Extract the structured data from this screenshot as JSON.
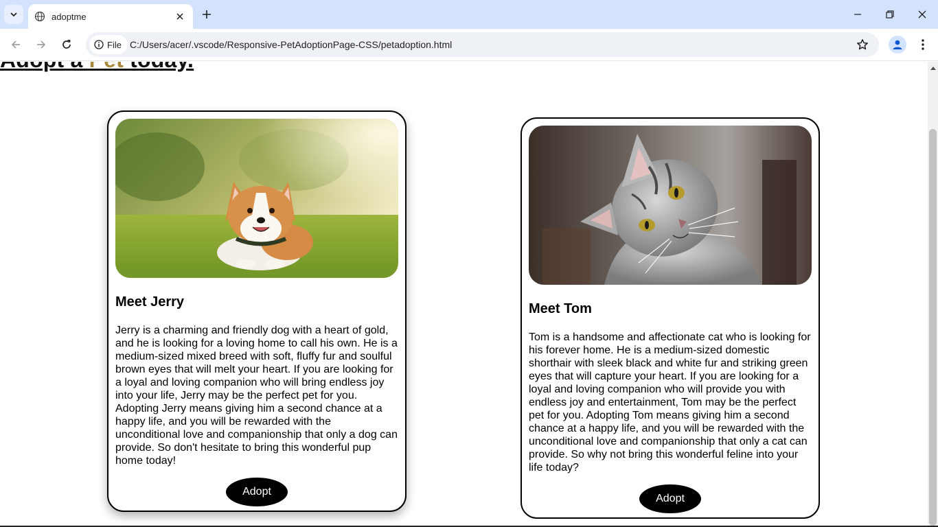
{
  "browser": {
    "tab_title": "adoptme",
    "omnibox": {
      "chip_label": "File",
      "url": "C:/Users/acer/.vscode/Responsive-PetAdoptionPage-CSS/petadoption.html"
    }
  },
  "page": {
    "heading_before": "Adopt a ",
    "heading_accent": "Pet",
    "heading_after": " today.",
    "pets": [
      {
        "name_heading": "Meet Jerry",
        "description": "Jerry is a charming and friendly dog with a heart of gold, and he is looking for a loving home to call his own. He is a medium-sized mixed breed with soft, fluffy fur and soulful brown eyes that will melt your heart. If you are looking for a loyal and loving companion who will bring endless joy into your life, Jerry may be the perfect pet for you. Adopting Jerry means giving him a second chance at a happy life, and you will be rewarded with the unconditional love and companionship that only a dog can provide. So don't hesitate to bring this wonderful pup home today!",
        "button_label": "Adopt",
        "photo_icon": "corgi-dog-photo"
      },
      {
        "name_heading": "Meet Tom",
        "description": "Tom is a handsome and affectionate cat who is looking for his forever home. He is a medium-sized domestic shorthair with sleek black and white fur and striking green eyes that will capture your heart. If you are looking for a loyal and loving companion who will provide you with endless joy and entertainment, Tom may be the perfect pet for you. Adopting Tom means giving him a second chance at a happy life, and you will be rewarded with the unconditional love and companionship that only a cat can provide. So why not bring this wonderful feline into your life today?",
        "button_label": "Adopt",
        "photo_icon": "tabby-cat-photo"
      }
    ]
  },
  "colors": {
    "tabstrip": "#d3e3fd",
    "heading_accent": "#a98a3c",
    "button_bg": "#000000",
    "button_text": "#ffffff",
    "card_border": "#000000"
  }
}
